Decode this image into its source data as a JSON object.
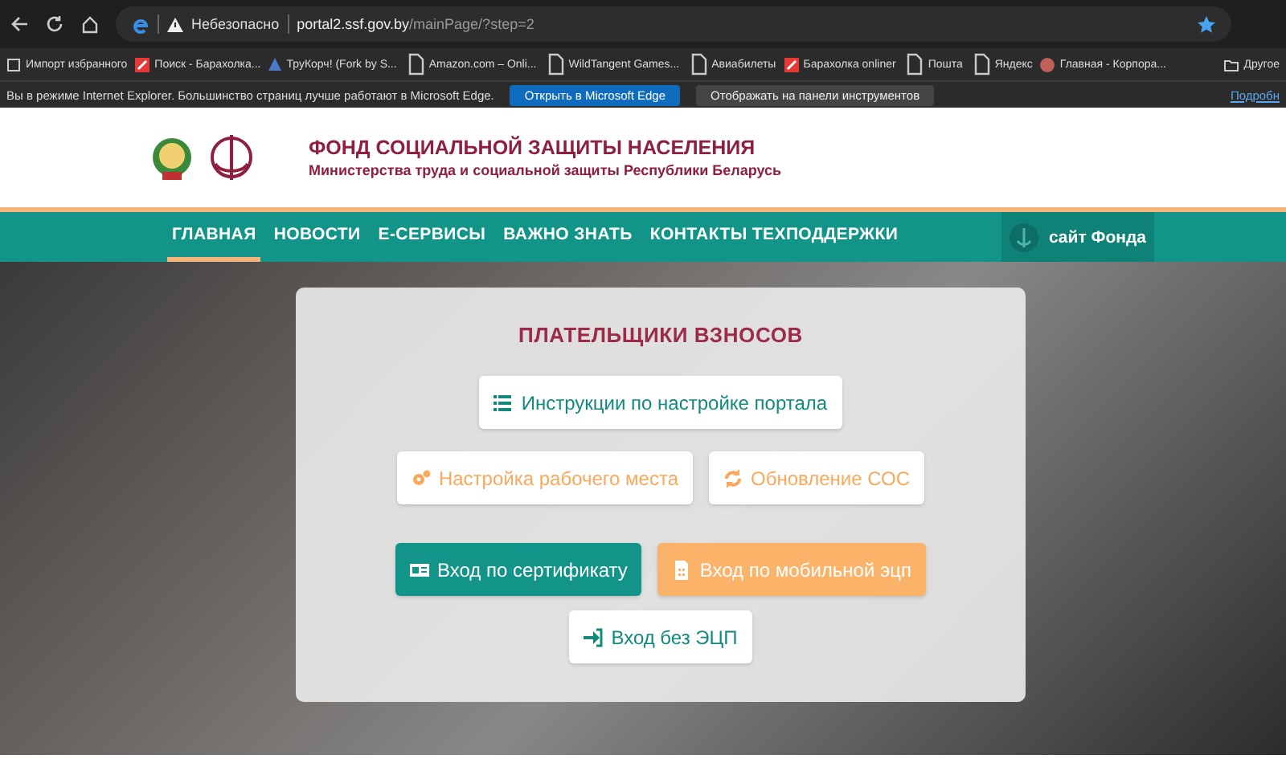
{
  "browser": {
    "security": "Небезопасно",
    "url_host": "portal2.ssf.gov.by",
    "url_path": "/mainPage/?step=2",
    "favorite": true
  },
  "bookmarks": [
    "Импорт избранного",
    "Поиск - Барахолка...",
    "ТруКорч! (Fork by S...",
    "Amazon.com – Onli...",
    "WildTangent Games...",
    "Авиабилеты",
    "Барахолка onliner",
    "Пошта",
    "Яндекс",
    "Главная - Корпора...",
    "Другое"
  ],
  "ie_bar": {
    "message": "Вы в режиме Internet Explorer. Большинство страниц лучше работают в Microsoft Edge.",
    "open_button": "Открыть в Microsoft Edge",
    "pin_button": "Отображать на панели инструментов",
    "link": "Подробн"
  },
  "site": {
    "title": "ФОНД СОЦИАЛЬНОЙ ЗАЩИТЫ НАСЕЛЕНИЯ",
    "subtitle": "Министерства труда и социальной защиты Республики Беларусь"
  },
  "nav": [
    {
      "label": "ГЛАВНАЯ",
      "selected": true
    },
    {
      "label": "НОВОСТИ",
      "selected": false
    },
    {
      "label": "Е-СЕРВИСЫ",
      "selected": false
    },
    {
      "label": "ВАЖНО ЗНАТЬ",
      "selected": false
    },
    {
      "label": "КОНТАКТЫ ТЕХПОДДЕРЖКИ",
      "selected": false
    }
  ],
  "fund_link": "сайт Фонда",
  "panel": {
    "title": "ПЛАТЕЛЬЩИКИ ВЗНОСОВ",
    "rows": [
      [
        {
          "label": "Инструкции по настройке портала",
          "kind": "light-teal"
        }
      ],
      [
        {
          "label": "Настройка рабочего места",
          "kind": "light-orange"
        },
        {
          "label": "Обновление СОС",
          "kind": "light-orange"
        }
      ],
      [
        {
          "label": "Вход по сертификату",
          "kind": "teal"
        },
        {
          "label": "Вход по мобильной эцп",
          "kind": "orange"
        }
      ],
      [
        {
          "label": "Вход без ЭЦП",
          "kind": "light-teal"
        }
      ]
    ]
  }
}
